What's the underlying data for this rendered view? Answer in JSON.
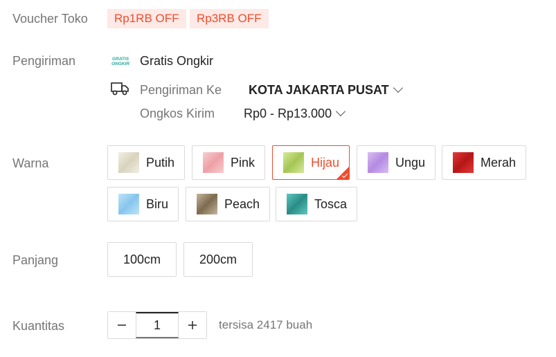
{
  "voucher": {
    "label": "Voucher Toko",
    "items": [
      "Rp1RB OFF",
      "Rp3RB OFF"
    ]
  },
  "shipping": {
    "label": "Pengiriman",
    "free_shipping_badge": "GRATIS ONGKIR",
    "free_shipping": "Gratis Ongkir",
    "to_label": "Pengiriman Ke",
    "destination": "KOTA JAKARTA PUSAT",
    "cost_label": "Ongkos Kirim",
    "cost": "Rp0 - Rp13.000"
  },
  "color": {
    "label": "Warna",
    "selected": "Hijau",
    "options": [
      {
        "name": "Putih",
        "swatch": "#f1efe4",
        "accent": "#d8d3bd"
      },
      {
        "name": "Pink",
        "swatch": "#f7cfcf",
        "accent": "#ee9fa7"
      },
      {
        "name": "Hijau",
        "swatch": "#d7ea9a",
        "accent": "#a4c656"
      },
      {
        "name": "Ungu",
        "swatch": "#d9bdf2",
        "accent": "#b48ae2"
      },
      {
        "name": "Merah",
        "swatch": "#e23a3a",
        "accent": "#b51616"
      },
      {
        "name": "Biru",
        "swatch": "#bfe3f8",
        "accent": "#86c6ec"
      },
      {
        "name": "Peach",
        "swatch": "#c7b69b",
        "accent": "#7d6a4f"
      },
      {
        "name": "Tosca",
        "swatch": "#5ec7c1",
        "accent": "#2a8c86"
      }
    ]
  },
  "length": {
    "label": "Panjang",
    "options": [
      "100cm",
      "200cm"
    ]
  },
  "quantity": {
    "label": "Kuantitas",
    "value": "1",
    "stock": "tersisa 2417 buah"
  },
  "colors": {
    "accent": "#ee4d2d",
    "label_gray": "#757575",
    "border": "#d9d9d9",
    "free_shipping_green": "#26aa99"
  }
}
